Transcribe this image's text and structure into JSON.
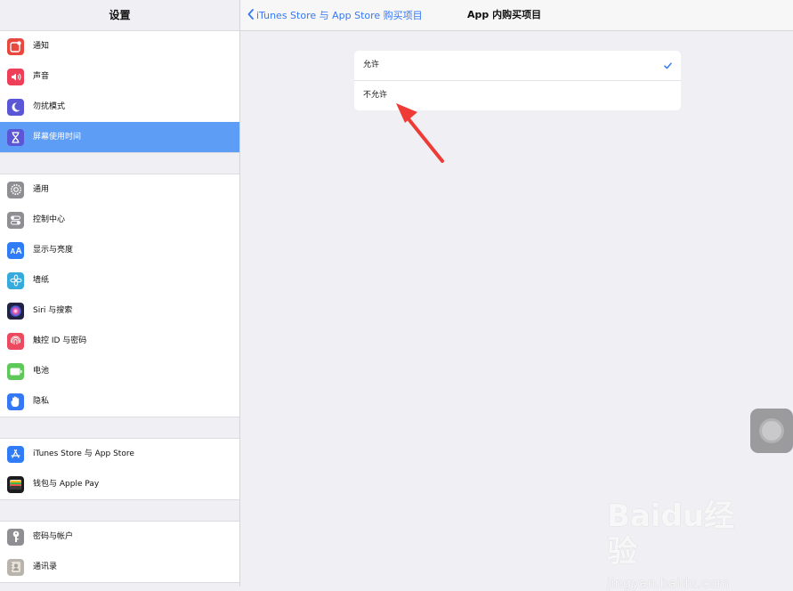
{
  "sidebar": {
    "title": "设置",
    "groups": [
      [
        {
          "label": "通知",
          "icon": "notifications-icon",
          "color": "#e9483f"
        },
        {
          "label": "声音",
          "icon": "sounds-icon",
          "color": "#ee3f58"
        },
        {
          "label": "勿扰模式",
          "icon": "do-not-disturb-icon",
          "color": "#5b56d6"
        },
        {
          "label": "屏幕使用时间",
          "icon": "screen-time-icon",
          "color": "#5b56d6",
          "selected": true
        }
      ],
      [
        {
          "label": "通用",
          "icon": "general-icon",
          "color": "#8e8e93"
        },
        {
          "label": "控制中心",
          "icon": "control-center-icon",
          "color": "#8e8e93"
        },
        {
          "label": "显示与亮度",
          "icon": "display-brightness-icon",
          "color": "#2f7cf6"
        },
        {
          "label": "墙纸",
          "icon": "wallpaper-icon",
          "color": "#35aadc"
        },
        {
          "label": "Siri 与搜索",
          "icon": "siri-icon",
          "color": "#222244"
        },
        {
          "label": "触控 ID 与密码",
          "icon": "touch-id-icon",
          "color": "#ec4a5e"
        },
        {
          "label": "电池",
          "icon": "battery-icon",
          "color": "#5fc85a"
        },
        {
          "label": "隐私",
          "icon": "privacy-icon",
          "color": "#3478f6"
        }
      ],
      [
        {
          "label": "iTunes Store 与 App Store",
          "icon": "app-store-icon",
          "color": "#2f7cf6"
        },
        {
          "label": "钱包与 Apple Pay",
          "icon": "wallet-icon",
          "color": "#1c1c1e"
        }
      ],
      [
        {
          "label": "密码与帐户",
          "icon": "passwords-accounts-icon",
          "color": "#8e8e93"
        },
        {
          "label": "通讯录",
          "icon": "contacts-icon",
          "color": "#b9b5ad"
        }
      ]
    ]
  },
  "navbar": {
    "back_label": "iTunes Store 与 App Store 购买项目",
    "title": "App 内购买项目"
  },
  "options": [
    {
      "label": "允许",
      "checked": true
    },
    {
      "label": "不允许",
      "checked": false
    }
  ],
  "watermark": {
    "logo": "Baidu经验",
    "url": "jingyan.baidu.com"
  },
  "colors": {
    "accent": "#3478f6",
    "selected_row": "#5e9df6",
    "annotation_arrow": "#ee3b36"
  }
}
